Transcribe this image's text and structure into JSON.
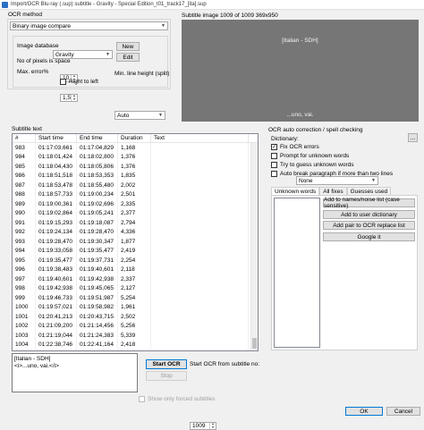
{
  "window": {
    "title": "Import/OCR Blu-ray (.sup) subtitle - Gravity - Special Edition_t01_track17_[ita].sup"
  },
  "ocr_method": {
    "label": "OCR method",
    "selected": "Binary image compare",
    "image_database_label": "Image database",
    "image_database_value": "Gravity",
    "new_button": "New",
    "edit_button": "Edit",
    "pixels_space_label": "No of pixels is space",
    "pixels_space_value": "10",
    "max_error_label": "Max. error%",
    "max_error_value": "1,5",
    "right_to_left_label": "Right to left",
    "min_line_height_label": "Min. line height (split)",
    "min_line_height_value": "Auto"
  },
  "subtitle_image": {
    "label": "Subtitle image 1009 of 1009   369x950",
    "line1": "[Italian - SDH]",
    "line2": "...uno, vai."
  },
  "subtitle_text": {
    "label": "Subtitle text",
    "columns": [
      "#",
      "Start time",
      "End time",
      "Duration",
      "Text"
    ],
    "rows": [
      [
        "983",
        "01:17:03,661",
        "01:17:04,829",
        "1,168"
      ],
      [
        "984",
        "01:18:01,424",
        "01:18:02,800",
        "1,376"
      ],
      [
        "985",
        "01:18:04,430",
        "01:18:05,806",
        "1,376"
      ],
      [
        "986",
        "01:18:51,518",
        "01:18:53,353",
        "1,835"
      ],
      [
        "987",
        "01:18:53,478",
        "01:18:55,480",
        "2,002"
      ],
      [
        "988",
        "01:18:57,733",
        "01:19:00,234",
        "2,501"
      ],
      [
        "989",
        "01:19:00,361",
        "01:19:02,696",
        "2,335"
      ],
      [
        "990",
        "01:19:02,864",
        "01:19:05,241",
        "2,377"
      ],
      [
        "991",
        "01:19:15,293",
        "01:19:18,087",
        "2,794"
      ],
      [
        "992",
        "01:19:24,134",
        "01:19:28,470",
        "4,336"
      ],
      [
        "993",
        "01:19:28,470",
        "01:19:30,347",
        "1,877"
      ],
      [
        "994",
        "01:19:33,058",
        "01:19:35,477",
        "2,419"
      ],
      [
        "995",
        "01:19:35,477",
        "01:19:37,731",
        "2,254"
      ],
      [
        "996",
        "01:19:38,483",
        "01:19:40,601",
        "2,118"
      ],
      [
        "997",
        "01:19:40,601",
        "01:19:42,938",
        "2,337"
      ],
      [
        "998",
        "01:19:42,938",
        "01:19:45,065",
        "2,127"
      ],
      [
        "999",
        "01:19:46,733",
        "01:19:51,987",
        "5,254"
      ],
      [
        "1000",
        "01:19:57,021",
        "01:19:58,982",
        "1,961"
      ],
      [
        "1001",
        "01:20:41,213",
        "01:20:43,715",
        "2,502"
      ],
      [
        "1002",
        "01:21:09,200",
        "01:21:14,456",
        "5,256"
      ],
      [
        "1003",
        "01:21:19,044",
        "01:21:24,383",
        "5,339"
      ],
      [
        "1004",
        "01:22:38,746",
        "01:22:41,164",
        "2,418"
      ],
      [
        "1005",
        "01:22:43,126",
        "01:22:45,003",
        "1,877"
      ],
      [
        "1006",
        "01:23:18,994",
        "01:23:20,454",
        "1,460"
      ]
    ]
  },
  "ocr_correction": {
    "label": "OCR auto correction / spell checking",
    "dictionary_label": "Dictionary:",
    "dictionary_value": "None",
    "more_button": "...",
    "fix_ocr_errors": "Fix OCR errors",
    "prompt_unknown": "Prompt for unknown words",
    "try_guess": "Try to guess unknown words",
    "auto_break": "Auto break paragraph if more than two lines",
    "tabs": [
      "Unknown words",
      "All fixes",
      "Guesses used"
    ],
    "add_names_button": "Add to names/noise list (case sensitive)",
    "add_user_dict_button": "Add to user dictionary",
    "add_pair_button": "Add pair to OCR replace list",
    "google_button": "Google it"
  },
  "bottom": {
    "text_line1": "[Italian - SDH]",
    "text_line2": "<i>...uno, vai.</i>",
    "start_ocr_button": "Start OCR",
    "stop_button": "Stop",
    "start_from_label": "Start OCR from subtitle no:",
    "start_from_value": "1009",
    "forced_only_label": "Show only forced subtitles",
    "ok_button": "OK",
    "cancel_button": "Cancel"
  }
}
